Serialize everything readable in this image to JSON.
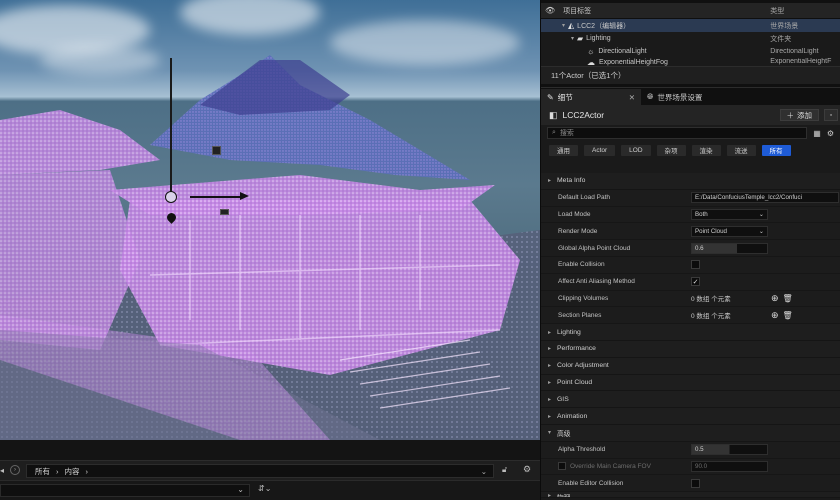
{
  "outliner": {
    "col_label": "项目标签",
    "col_type": "类型",
    "rows": [
      {
        "label": "LCC2（编辑器）",
        "type": "世界场景"
      },
      {
        "label": "Lighting",
        "type": "文件夹"
      },
      {
        "label": "DirectionalLight",
        "type": "DirectionalLight"
      },
      {
        "label": "ExponentialHeightFog",
        "type": "ExponentialHeightF"
      }
    ],
    "status": "11个Actor（已选1个）"
  },
  "tabs": [
    {
      "label": "细节"
    },
    {
      "label": "世界场景设置"
    }
  ],
  "details": {
    "actor_name": "LCC2Actor",
    "add_label": "添加",
    "search_placeholder": "搜索",
    "filters": [
      "通用",
      "Actor",
      "LOD",
      "杂项",
      "渲染",
      "流送",
      "所有"
    ],
    "categories": {
      "meta_info": "Meta Info",
      "lighting": "Lighting",
      "performance": "Performance",
      "color_adjustment": "Color Adjustment",
      "point_cloud": "Point Cloud",
      "gis": "GIS",
      "animation": "Animation",
      "advanced": "高级",
      "last": "物理"
    },
    "props": {
      "default_load_path": {
        "label": "Default Load Path",
        "value": "E:/Data/ConfuciusTemple_lcc2/Confuci"
      },
      "load_mode": {
        "label": "Load Mode",
        "value": "Both"
      },
      "render_mode": {
        "label": "Render Mode",
        "value": "Point Cloud"
      },
      "global_alpha": {
        "label": "Global Alpha Point Cloud",
        "value": "0.6"
      },
      "enable_collision": {
        "label": "Enable Collision"
      },
      "affect_aa": {
        "label": "Affect Anti Aliasing Method"
      },
      "clipping_volumes": {
        "label": "Clipping Volumes",
        "value": "0 数组 个元素"
      },
      "section_planes": {
        "label": "Section Planes",
        "value": "0 数组 个元素"
      },
      "alpha_threshold": {
        "label": "Alpha Threshold",
        "value": "0.5"
      },
      "override_fov": {
        "label": "Override Main Camera FOV",
        "value": "90.0"
      },
      "enable_editor_collision": {
        "label": "Enable Editor Collision"
      }
    }
  },
  "content_browser": {
    "path": [
      "所有",
      "内容"
    ]
  },
  "colors": {
    "accent": "#1e5bd6",
    "panel": "#1a1a1a",
    "point_cloud": "#c78be6"
  }
}
